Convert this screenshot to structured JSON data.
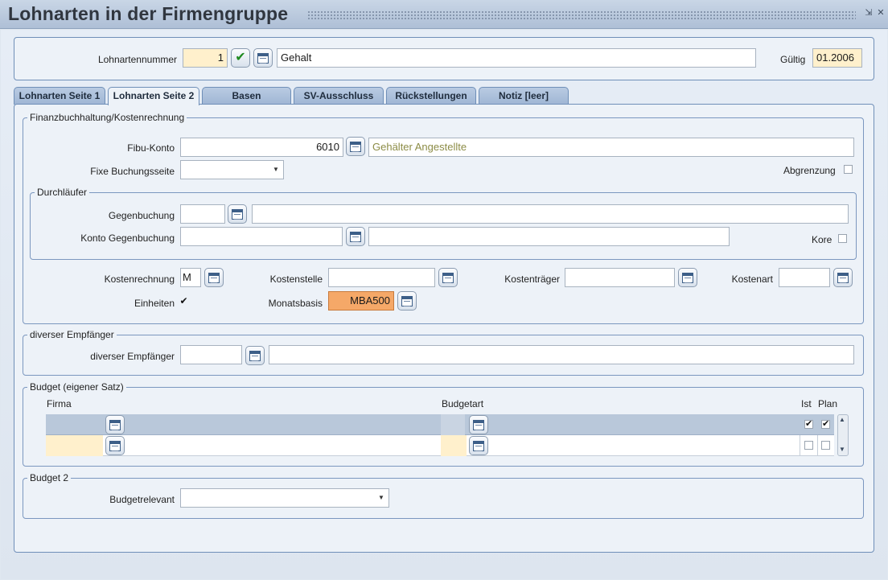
{
  "window": {
    "title": "Lohnarten in der Firmengruppe",
    "minimize_glyph": "⇲",
    "close_glyph": "✕"
  },
  "header": {
    "lohnartennummer_label": "Lohnartennummer",
    "lohnartennummer_value": "1",
    "bezeichnung_value": "Gehalt",
    "gueltig_label": "Gültig",
    "gueltig_value": "01.2006"
  },
  "tabs": [
    {
      "label": "Lohnarten Seite 1",
      "active": false
    },
    {
      "label": "Lohnarten Seite 2",
      "active": true
    },
    {
      "label": "Basen",
      "active": false
    },
    {
      "label": "SV-Ausschluss",
      "active": false
    },
    {
      "label": "Rückstellungen",
      "active": false
    },
    {
      "label": "Notiz [leer]",
      "active": false
    }
  ],
  "finanz": {
    "legend": "Finanzbuchhaltung/Kostenrechnung",
    "fibu_label": "Fibu-Konto",
    "fibu_value": "6010",
    "fibu_desc": "Gehälter Angestellte",
    "fixe_label": "Fixe Buchungsseite",
    "fixe_value": "",
    "abgrenzung_label": "Abgrenzung",
    "durchlaeufer": {
      "legend": "Durchläufer",
      "gegenbuchung_label": "Gegenbuchung",
      "gegenbuchung_value": "",
      "gegenbuchung_desc": "",
      "konto_gegenbuchung_label": "Konto Gegenbuchung",
      "konto_gegenbuchung_value": "",
      "konto_gegenbuchung_desc": "",
      "kore_label": "Kore"
    },
    "kostenrechnung_label": "Kostenrechnung",
    "kostenrechnung_value": "M",
    "kostenstelle_label": "Kostenstelle",
    "kostenstelle_value": "",
    "kostentraeger_label": "Kostenträger",
    "kostentraeger_value": "",
    "kostenart_label": "Kostenart",
    "kostenart_value": "",
    "einheiten_label": "Einheiten",
    "einheiten_checked": "✔",
    "monatsbasis_label": "Monatsbasis",
    "monatsbasis_value": "MBA500"
  },
  "empfaenger": {
    "legend": "diverser Empfänger",
    "label": "diverser Empfänger",
    "value": "",
    "desc": ""
  },
  "budget": {
    "legend": "Budget (eigener Satz)",
    "col_firma": "Firma",
    "col_budgetart": "Budgetart",
    "col_ist": "Ist",
    "col_plan": "Plan",
    "header_ist_check": "✔",
    "header_plan_check": "✔",
    "scroll_up": "▲",
    "scroll_down": "▼"
  },
  "budget2": {
    "legend": "Budget 2",
    "budgetrelevant_label": "Budgetrelevant",
    "budgetrelevant_value": ""
  },
  "colors": {
    "accent": "#6f8fb8",
    "highlight_yellow": "#fff0cc",
    "highlight_orange": "#f5a868"
  }
}
